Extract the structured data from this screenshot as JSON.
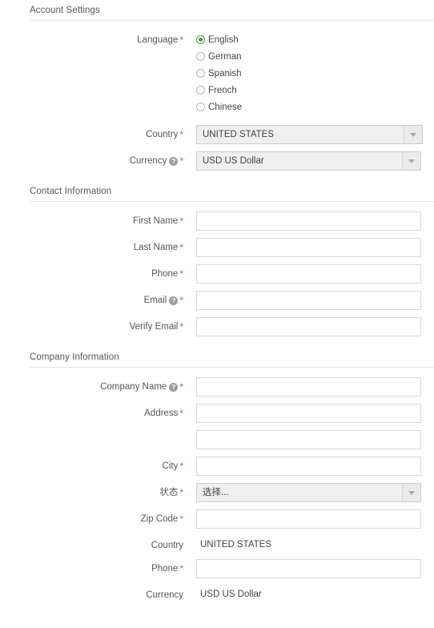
{
  "sections": {
    "account": {
      "title": "Account Settings",
      "language": {
        "label": "Language",
        "required": "*",
        "options": [
          {
            "label": "English",
            "selected": true
          },
          {
            "label": "German",
            "selected": false
          },
          {
            "label": "Spanish",
            "selected": false
          },
          {
            "label": "French",
            "selected": false
          },
          {
            "label": "Chinese",
            "selected": false
          }
        ]
      },
      "country": {
        "label": "Country",
        "required": "*",
        "value": "UNITED STATES"
      },
      "currency": {
        "label": "Currency",
        "required": "*",
        "help": "?",
        "value": "USD US Dollar"
      }
    },
    "contact": {
      "title": "Contact Information",
      "fields": [
        {
          "label": "First Name",
          "required": "*",
          "value": "",
          "placeholder": ""
        },
        {
          "label": "Last Name",
          "required": "*",
          "value": "",
          "placeholder": ""
        },
        {
          "label": "Phone",
          "required": "*",
          "value": "",
          "placeholder": ""
        },
        {
          "label": "Email",
          "required": "*",
          "help": "?",
          "value": "",
          "placeholder": ""
        },
        {
          "label": "Verify Email",
          "required": "*",
          "value": "",
          "placeholder": ""
        }
      ]
    },
    "company": {
      "title": "Company Information",
      "company_name": {
        "label": "Company Name",
        "required": "*",
        "help": "?",
        "value": "",
        "placeholder": ""
      },
      "address1": {
        "label": "Address",
        "required": "*",
        "value": "",
        "placeholder": ""
      },
      "address2": {
        "label": "",
        "required": "",
        "value": "",
        "placeholder": ""
      },
      "city": {
        "label": "City",
        "required": "*",
        "value": "",
        "placeholder": ""
      },
      "state": {
        "label": "状态",
        "required": "*",
        "value": "选择..."
      },
      "zip": {
        "label": "Zip Code",
        "required": "*",
        "value": "",
        "placeholder": ""
      },
      "country": {
        "label": "Country",
        "value": "UNITED STATES"
      },
      "phone": {
        "label": "Phone",
        "required": "*",
        "value": "",
        "placeholder": ""
      },
      "currency": {
        "label": "Currency",
        "value": "USD US Dollar"
      }
    }
  },
  "colors": {
    "required_red": "#d9534f",
    "radio_green": "#3f9c46",
    "text": "#444444",
    "label": "#555555",
    "rule": "#e4e4e4",
    "input_border": "#d8d8d8",
    "select_bg": "#efefef"
  },
  "icons": {
    "help": "help-circle-icon",
    "dropdown": "chevron-down-icon",
    "radio": "radio-button-icon"
  }
}
